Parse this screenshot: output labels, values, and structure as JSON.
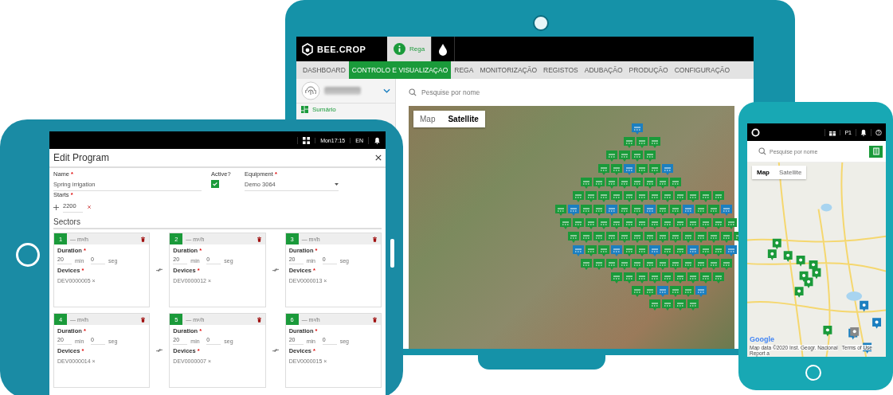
{
  "monitor": {
    "logo": "BEE.CROP",
    "app_tabs": [
      {
        "kind": "info",
        "label": "Rega",
        "selected": true
      },
      {
        "kind": "drop",
        "selected": false
      }
    ],
    "nav": [
      {
        "label": "DASHBOARD",
        "selected": false
      },
      {
        "label": "CONTROLO E VISUALIZAÇAO",
        "selected": true
      },
      {
        "label": "REGA",
        "selected": false
      },
      {
        "label": "MONITORIZAÇÃO",
        "selected": false
      },
      {
        "label": "REGISTOS",
        "selected": false
      },
      {
        "label": "ADUBAÇÃO",
        "selected": false
      },
      {
        "label": "PRODUÇÃO",
        "selected": false
      },
      {
        "label": "CONFIGURAÇÃO",
        "selected": false
      }
    ],
    "sidebar": {
      "items": [
        {
          "label": "Sumário",
          "selected": true
        }
      ]
    },
    "search": {
      "placeholder": "Pesquise por nome"
    },
    "map_types": [
      {
        "label": "Map",
        "selected": false
      },
      {
        "label": "Satellite",
        "selected": true
      }
    ]
  },
  "tablet": {
    "status": {
      "time": "Mon17:15",
      "language": "EN"
    },
    "title": "Edit Program",
    "form": {
      "name": {
        "label": "Name",
        "mark": "*",
        "value": "Spring irrigation"
      },
      "active": {
        "label": "Active?",
        "checked": true
      },
      "equipment": {
        "label": "Equipment",
        "mark": "*",
        "value": "Demo 3064"
      },
      "starts": {
        "label": "Starts",
        "mark": "*",
        "value": "2200"
      }
    },
    "sectors_title": "Sectors",
    "sectors": [
      {
        "number": "1",
        "flow": "— m³/h",
        "duration_label": "Duration",
        "duration_mark": "*",
        "minutes": "20",
        "min_unit": "min",
        "seconds": "0",
        "sec_unit": "seg",
        "devices_label": "Devices",
        "devices_mark": "*",
        "device": "DEV0000005 ×"
      },
      {
        "number": "2",
        "flow": "— m³/h",
        "duration_label": "Duration",
        "duration_mark": "*",
        "minutes": "20",
        "min_unit": "min",
        "seconds": "0",
        "sec_unit": "seg",
        "devices_label": "Devices",
        "devices_mark": "*",
        "device": "DEV0000012 ×"
      },
      {
        "number": "3",
        "flow": "— m³/h",
        "duration_label": "Duration",
        "duration_mark": "*",
        "minutes": "20",
        "min_unit": "min",
        "seconds": "0",
        "sec_unit": "seg",
        "devices_label": "Devices",
        "devices_mark": "*",
        "device": "DEV0000013 ×"
      },
      {
        "number": "4",
        "flow": "— m³/h",
        "duration_label": "Duration",
        "duration_mark": "*",
        "minutes": "20",
        "min_unit": "min",
        "seconds": "0",
        "sec_unit": "seg",
        "devices_label": "Devices",
        "devices_mark": "*",
        "device": "DEV0000014 ×"
      },
      {
        "number": "5",
        "flow": "— m³/h",
        "duration_label": "Duration",
        "duration_mark": "*",
        "minutes": "20",
        "min_unit": "min",
        "seconds": "0",
        "sec_unit": "seg",
        "devices_label": "Devices",
        "devices_mark": "*",
        "device": "DEV0000007 ×"
      },
      {
        "number": "6",
        "flow": "— m³/h",
        "duration_label": "Duration",
        "duration_mark": "*",
        "minutes": "20",
        "min_unit": "min",
        "seconds": "0",
        "sec_unit": "seg",
        "devices_label": "Devices",
        "devices_mark": "*",
        "device": "DEV0000015 ×"
      }
    ]
  },
  "phone": {
    "status": {
      "indicator": "P1"
    },
    "search": {
      "placeholder": "Pesquise por nome"
    },
    "map_types": [
      {
        "label": "Map",
        "selected": true
      },
      {
        "label": "Satellite",
        "selected": false
      }
    ],
    "map_logo": "Google",
    "attribution": [
      "Map data ©2020 Inst. Geogr. Nacional",
      "Terms of Use",
      "Report a"
    ]
  }
}
